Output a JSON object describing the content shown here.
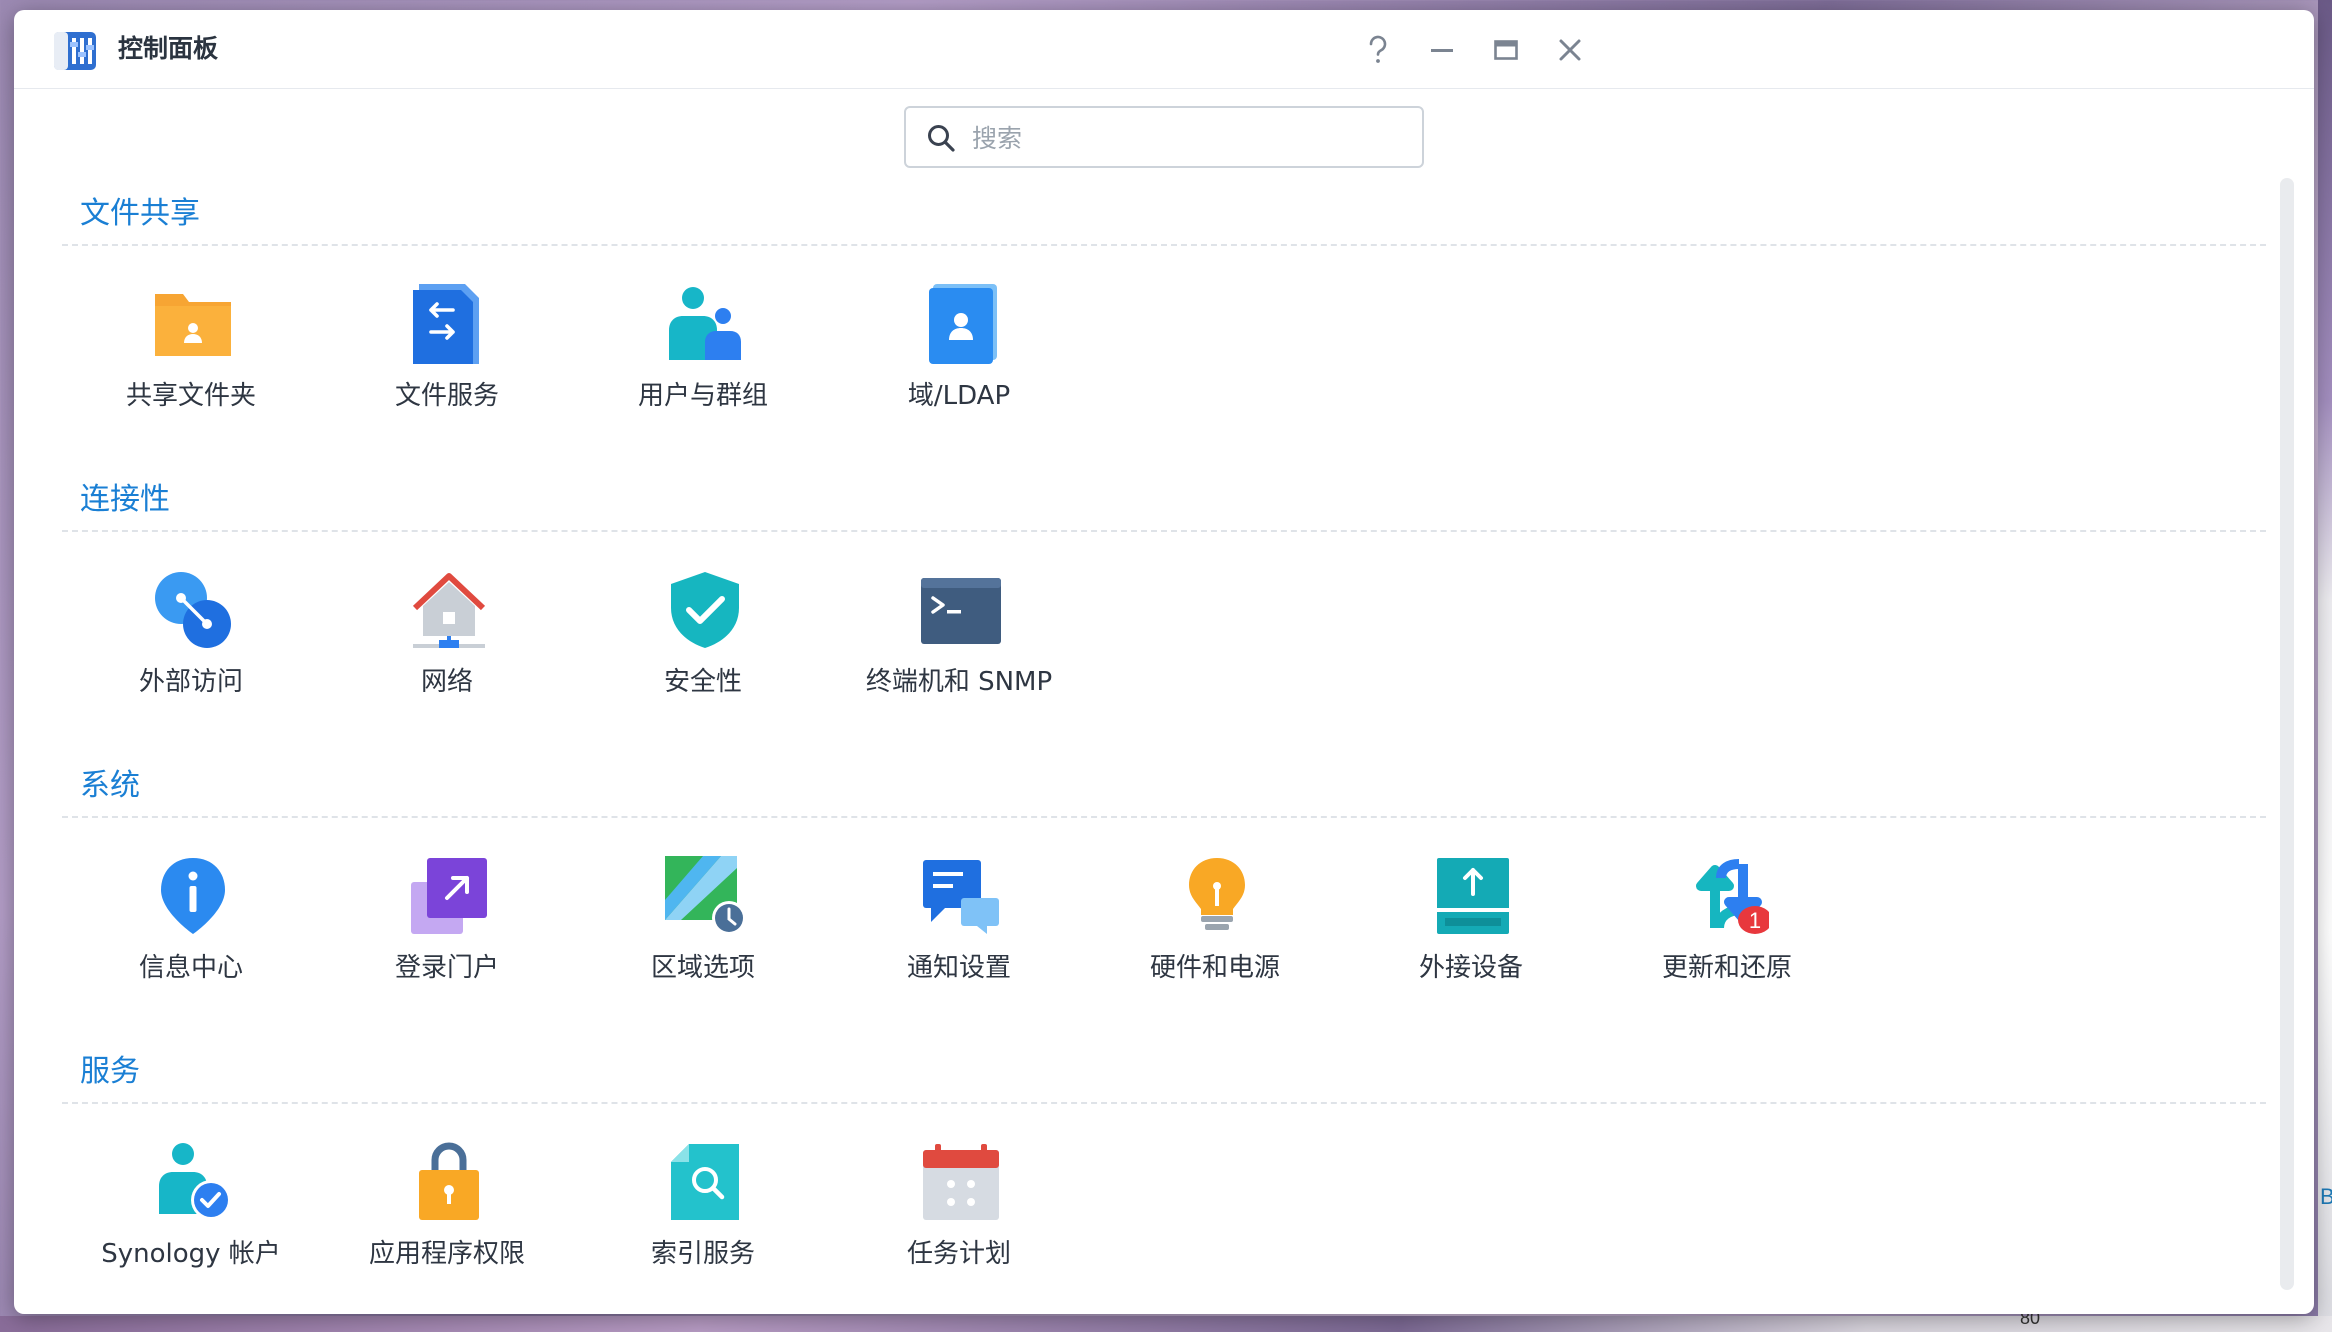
{
  "window": {
    "title": "控制面板",
    "app_icon": "control-panel-icon",
    "controls": [
      "help-icon",
      "minimize-icon",
      "maximize-icon",
      "close-icon"
    ]
  },
  "search": {
    "placeholder": "搜索",
    "value": ""
  },
  "sections": [
    {
      "title": "文件共享",
      "items": [
        {
          "label": "共享文件夹",
          "icon": "shared-folder-icon"
        },
        {
          "label": "文件服务",
          "icon": "file-services-icon"
        },
        {
          "label": "用户与群组",
          "icon": "users-groups-icon"
        },
        {
          "label": "域/LDAP",
          "icon": "domain-ldap-icon"
        }
      ]
    },
    {
      "title": "连接性",
      "items": [
        {
          "label": "外部访问",
          "icon": "external-access-icon"
        },
        {
          "label": "网络",
          "icon": "network-icon"
        },
        {
          "label": "安全性",
          "icon": "security-shield-icon"
        },
        {
          "label": "终端机和 SNMP",
          "icon": "terminal-icon"
        }
      ]
    },
    {
      "title": "系统",
      "items": [
        {
          "label": "信息中心",
          "icon": "info-center-icon"
        },
        {
          "label": "登录门户",
          "icon": "login-portal-icon"
        },
        {
          "label": "区域选项",
          "icon": "regional-options-icon"
        },
        {
          "label": "通知设置",
          "icon": "notification-icon"
        },
        {
          "label": "硬件和电源",
          "icon": "hardware-power-icon"
        },
        {
          "label": "外接设备",
          "icon": "external-devices-icon"
        },
        {
          "label": "更新和还原",
          "icon": "update-restore-icon",
          "badge": "1"
        }
      ]
    },
    {
      "title": "服务",
      "items": [
        {
          "label": "Synology 帐户",
          "icon": "synology-account-icon"
        },
        {
          "label": "应用程序权限",
          "icon": "app-privileges-icon"
        },
        {
          "label": "索引服务",
          "icon": "indexing-service-icon"
        },
        {
          "label": "任务计划",
          "icon": "task-scheduler-icon"
        }
      ]
    }
  ],
  "background_peek": {
    "right_text": "B",
    "bottom_text": "80"
  },
  "colors": {
    "section_title": "#1a7fd4",
    "badge": "#e8383d"
  }
}
